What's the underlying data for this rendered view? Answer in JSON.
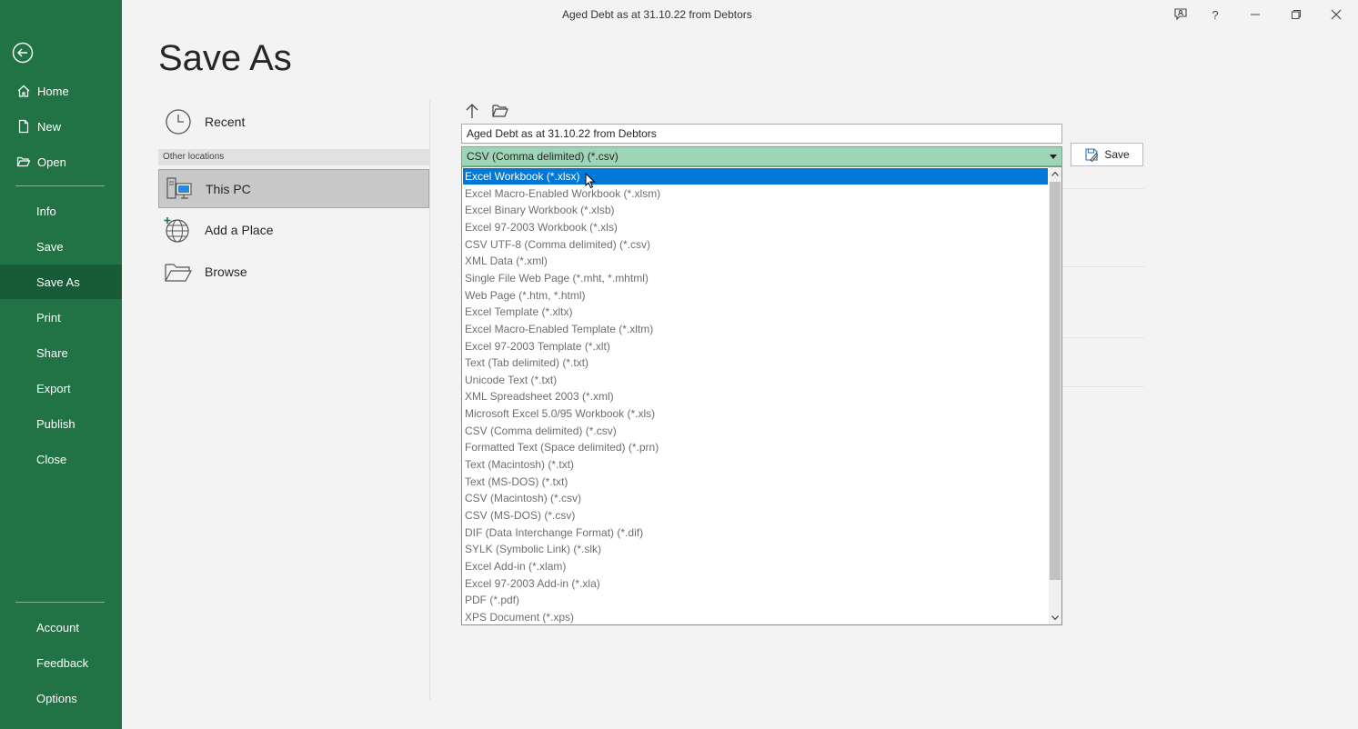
{
  "window": {
    "doc_title": "Aged Debt as at 31.10.22 from Debtors",
    "controls": [
      "feedback",
      "help",
      "minimize",
      "restore",
      "close"
    ]
  },
  "rail": {
    "back_icon": "back-arrow-icon",
    "items": [
      {
        "label": "Home",
        "icon": "home-icon"
      },
      {
        "label": "New",
        "icon": "new-document-icon"
      },
      {
        "label": "Open",
        "icon": "open-folder-icon"
      },
      {
        "label": "Info"
      },
      {
        "label": "Save"
      },
      {
        "label": "Save As",
        "active": true
      },
      {
        "label": "Print"
      },
      {
        "label": "Share"
      },
      {
        "label": "Export"
      },
      {
        "label": "Publish"
      },
      {
        "label": "Close"
      },
      {
        "label": "Account"
      },
      {
        "label": "Feedback"
      },
      {
        "label": "Options"
      }
    ]
  },
  "page": {
    "title": "Save As"
  },
  "locations": {
    "recent": "Recent",
    "section_header": "Other locations",
    "this_pc": "This PC",
    "add_place": "Add a Place",
    "browse": "Browse"
  },
  "save_form": {
    "filename": "Aged Debt as at 31.10.22 from Debtors",
    "filetype_selected": "CSV (Comma delimited) (*.csv)",
    "save_label": "Save",
    "options": [
      "Excel Workbook (*.xlsx)",
      "Excel Macro-Enabled Workbook (*.xlsm)",
      "Excel Binary Workbook (*.xlsb)",
      "Excel 97-2003 Workbook (*.xls)",
      "CSV UTF-8 (Comma delimited) (*.csv)",
      "XML Data (*.xml)",
      "Single File Web Page (*.mht, *.mhtml)",
      "Web Page (*.htm, *.html)",
      "Excel Template (*.xltx)",
      "Excel Macro-Enabled Template (*.xltm)",
      "Excel 97-2003 Template (*.xlt)",
      "Text (Tab delimited) (*.txt)",
      "Unicode Text (*.txt)",
      "XML Spreadsheet 2003 (*.xml)",
      "Microsoft Excel 5.0/95 Workbook (*.xls)",
      "CSV (Comma delimited) (*.csv)",
      "Formatted Text (Space delimited) (*.prn)",
      "Text (Macintosh) (*.txt)",
      "Text (MS-DOS) (*.txt)",
      "CSV (Macintosh) (*.csv)",
      "CSV (MS-DOS) (*.csv)",
      "DIF (Data Interchange Format) (*.dif)",
      "SYLK (Symbolic Link) (*.slk)",
      "Excel Add-in (*.xlam)",
      "Excel 97-2003 Add-in (*.xla)",
      "PDF (*.pdf)",
      "XPS Document (*.xps)"
    ],
    "highlighted_option": "Excel Workbook (*.xlsx)"
  },
  "colors": {
    "rail": "#217346",
    "rail_active": "#185c37",
    "highlight": "#0078d7",
    "filetype_bg": "#9fd5b7"
  }
}
